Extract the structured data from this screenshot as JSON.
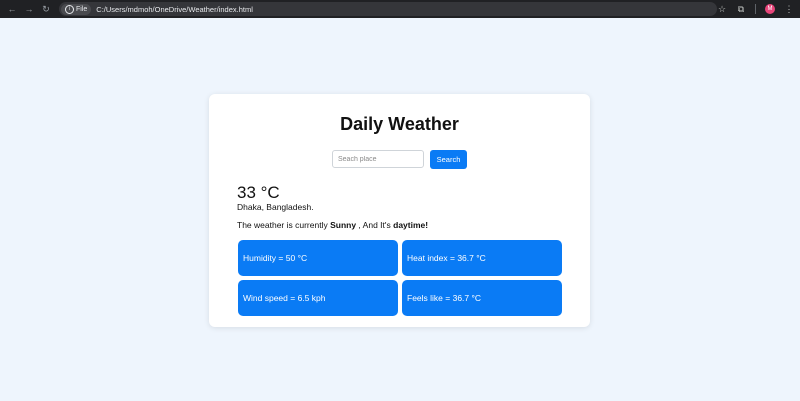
{
  "browser": {
    "back_icon": "←",
    "forward_icon": "→",
    "reload_icon": "↻",
    "chip_label": "File",
    "url": "C:/Users/mdmoh/OneDrive/Weather/index.html",
    "star_icon": "☆",
    "extensions_icon": "⧉",
    "avatar_letter": "M",
    "menu_icon": "⋮"
  },
  "app": {
    "title": "Daily Weather",
    "search_placeholder": "Seach place",
    "search_value": "",
    "search_button": "Search",
    "temperature": "33 °C",
    "location": "Dhaka, Bangladesh.",
    "status_prefix": "The weather is currently ",
    "condition": "Sunny",
    "status_middle": " , And It's ",
    "time_of_day": "daytime!",
    "stats": {
      "humidity": "Humidity = 50 °C",
      "heat_index": "Heat index = 36.7 °C",
      "wind_speed": "Wind speed = 6.5 kph",
      "feels_like": "Feels like = 36.7 °C"
    }
  },
  "colors": {
    "page_background": "#eef5fd",
    "accent": "#0a7bf5",
    "card": "#ffffff"
  }
}
